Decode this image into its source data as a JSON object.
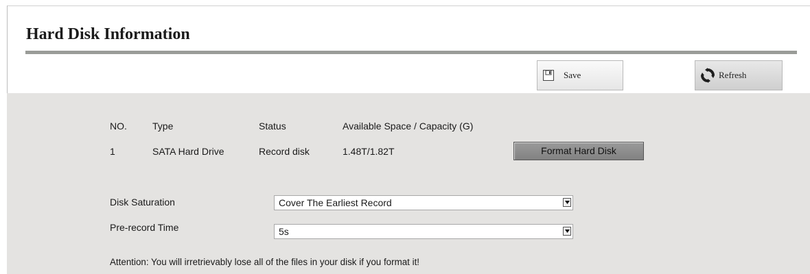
{
  "header": {
    "title": "Hard Disk Information"
  },
  "toolbar": {
    "save": {
      "label": "Save",
      "icon": "floppy-disk-icon"
    },
    "refresh": {
      "label": "Refresh",
      "icon": "refresh-icon"
    }
  },
  "disk_table": {
    "columns": [
      "NO.",
      "Type",
      "Status",
      "Available Space / Capacity (G)"
    ],
    "rows": [
      {
        "no": "1",
        "type": "SATA Hard Drive",
        "status": "Record disk",
        "space": "1.48T/1.82T"
      }
    ],
    "format_button": "Format Hard Disk"
  },
  "settings": {
    "disk_saturation": {
      "label": "Disk Saturation",
      "value": "Cover The Earliest Record"
    },
    "prerecord_time": {
      "label": "Pre-record Time",
      "value": "5s"
    }
  },
  "attention": "Attention: You will irretrievably lose all of the files in your disk if you format it!",
  "colors": {
    "panel_bg": "#e4e3e1",
    "rule": "#9a9c98",
    "format_button": "#8e8e8e"
  }
}
